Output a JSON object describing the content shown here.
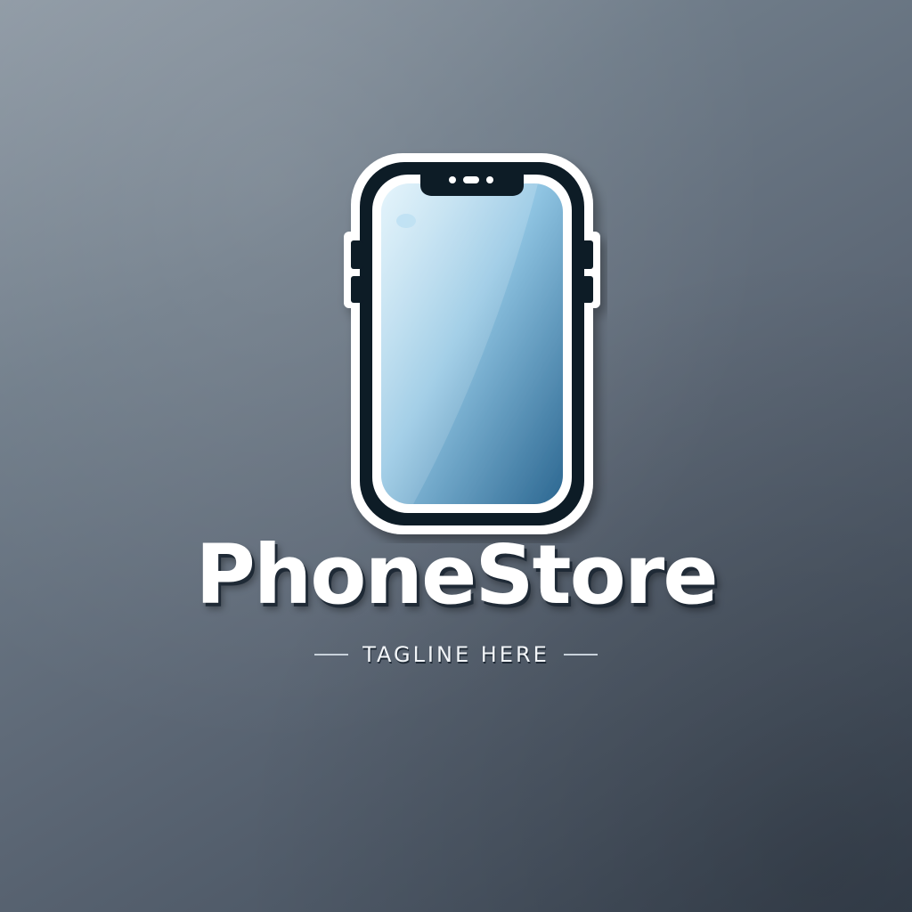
{
  "brand": {
    "name": "PhoneStore",
    "tagline": "TAGLINE HERE"
  },
  "icon": {
    "name": "smartphone-icon"
  },
  "colors": {
    "background_light": "#8e99a4",
    "background_dark": "#3a4553",
    "screen_light": "#cfe8f5",
    "screen_dark": "#2e6a93",
    "outline": "#0f1a26",
    "text": "#ffffff"
  }
}
